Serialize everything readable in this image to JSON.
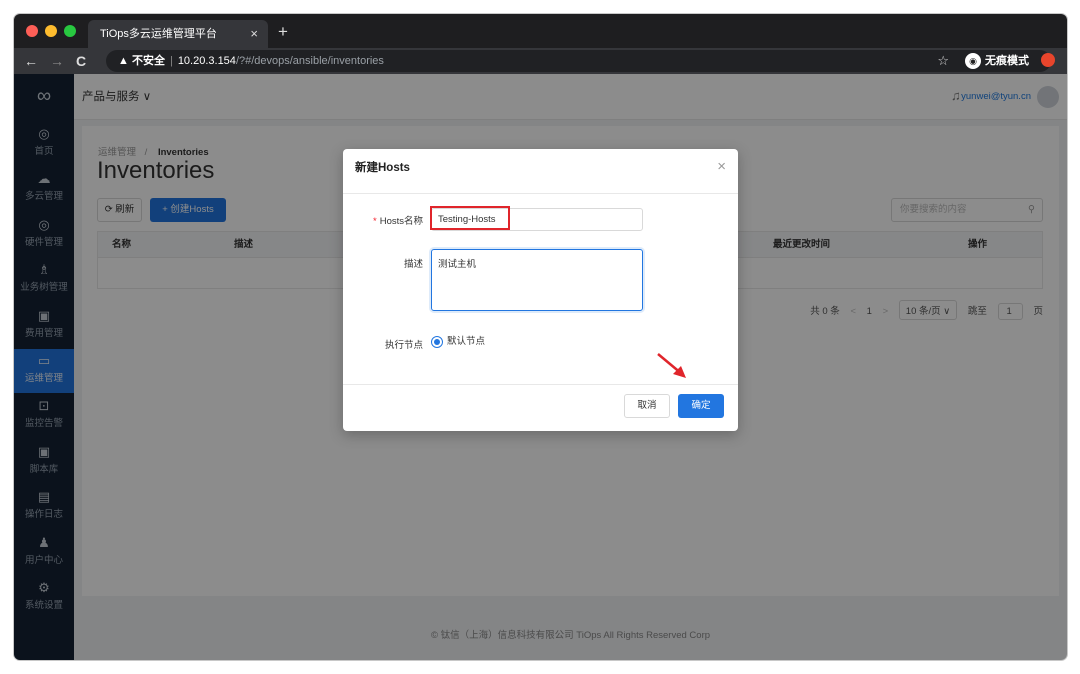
{
  "browser": {
    "tab_title": "TiOps多云运维管理平台",
    "tab_close": "×",
    "new_tab": "+",
    "back": "←",
    "forward": "→",
    "reload": "C",
    "security": "▲ 不安全",
    "url_host": "10.20.3.154",
    "url_path": "/?#/devops/ansible/inventories",
    "star": "☆",
    "incognito_label": "无痕模式"
  },
  "header": {
    "products": "产品与服务 ∨",
    "user": "yunwei@tyun.cn"
  },
  "sidebar": {
    "items": [
      {
        "icon": "◎",
        "label": "首页"
      },
      {
        "icon": "☁",
        "label": "多云管理"
      },
      {
        "icon": "◎",
        "label": "硬件管理"
      },
      {
        "icon": "♗",
        "label": "业务树管理"
      },
      {
        "icon": "▣",
        "label": "费用管理"
      },
      {
        "icon": "▭",
        "label": "运维管理"
      },
      {
        "icon": "⊡",
        "label": "监控告警"
      },
      {
        "icon": "▣",
        "label": "脚本库"
      },
      {
        "icon": "▤",
        "label": "操作日志"
      },
      {
        "icon": "♟",
        "label": "用户中心"
      },
      {
        "icon": "⚙",
        "label": "系统设置"
      }
    ],
    "active_index": 5
  },
  "page": {
    "breadcrumb_parent": "运维管理",
    "breadcrumb_current": "Inventories",
    "title": "Inventories",
    "refresh_label": "⟳ 刷新",
    "create_label": "+ 创建Hosts",
    "search_placeholder": "你要搜索的内容",
    "columns": [
      "名称",
      "描述",
      "最近更改时间",
      "操作"
    ],
    "pager": {
      "total": "共 0 条",
      "prev": "<",
      "page": "1",
      "next": ">",
      "page_size": "10 条/页 ∨",
      "goto_label": "跳至",
      "goto_value": "1",
      "goto_suffix": "页"
    }
  },
  "footer": "© 钛信（上海）信息科技有限公司 TiOps All Rights Reserved Corp",
  "modal": {
    "title": "新建Hosts",
    "close": "×",
    "name_label": "Hosts名称",
    "name_value": "Testing-Hosts",
    "desc_label": "描述",
    "desc_value": "测试主机",
    "node_label": "执行节点",
    "node_option": "默认节点",
    "cancel": "取消",
    "ok": "确定"
  }
}
